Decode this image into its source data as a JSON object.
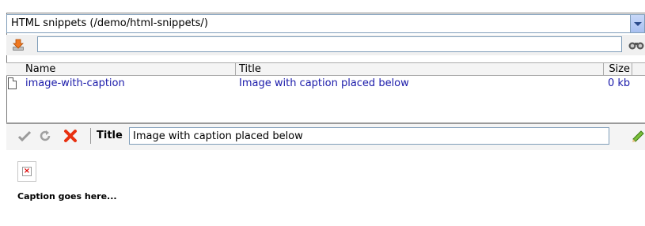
{
  "folder_select": {
    "value": "HTML snippets (/demo/html-snippets/)"
  },
  "search": {
    "value": ""
  },
  "table": {
    "columns": [
      "Name",
      "Title",
      "Size"
    ],
    "rows": [
      {
        "name": "image-with-caption",
        "title": "Image with caption placed below",
        "size": "0 kb"
      }
    ]
  },
  "editor": {
    "title_label": "Title",
    "title_value": "Image with caption placed below"
  },
  "preview": {
    "caption": "Caption goes here..."
  },
  "icons": {
    "download": "download-icon",
    "search": "binoculars-icon",
    "file": "file-icon",
    "accept": "check-icon",
    "refresh": "refresh-icon",
    "delete": "delete-icon",
    "edit": "pencil-icon",
    "broken_image": "broken-image-icon"
  }
}
